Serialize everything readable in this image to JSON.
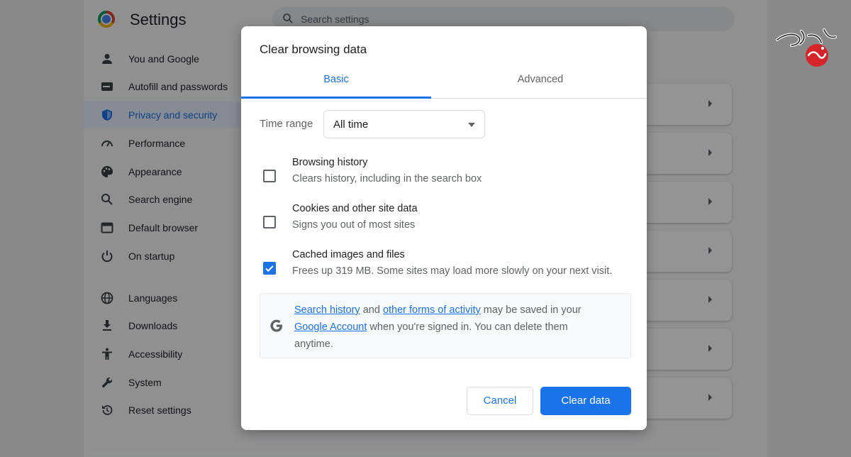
{
  "app": {
    "title": "Settings",
    "search_placeholder": "Search settings"
  },
  "nav": {
    "items": [
      {
        "label": "You and Google",
        "icon": "person-icon"
      },
      {
        "label": "Autofill and passwords",
        "icon": "card-icon"
      },
      {
        "label": "Privacy and security",
        "icon": "shield-icon",
        "active": true
      },
      {
        "label": "Performance",
        "icon": "speedometer-icon"
      },
      {
        "label": "Appearance",
        "icon": "palette-icon"
      },
      {
        "label": "Search engine",
        "icon": "search-icon"
      },
      {
        "label": "Default browser",
        "icon": "browser-icon"
      },
      {
        "label": "On startup",
        "icon": "power-icon"
      },
      {
        "label": "Languages",
        "icon": "globe-icon"
      },
      {
        "label": "Downloads",
        "icon": "download-icon"
      },
      {
        "label": "Accessibility",
        "icon": "accessibility-icon"
      },
      {
        "label": "System",
        "icon": "wrench-icon"
      },
      {
        "label": "Reset settings",
        "icon": "reset-icon"
      }
    ]
  },
  "dialog": {
    "title": "Clear browsing data",
    "tabs": {
      "basic": "Basic",
      "advanced": "Advanced"
    },
    "time_range": {
      "label": "Time range",
      "value": "All time"
    },
    "options": [
      {
        "title": "Browsing history",
        "desc": "Clears history, including in the search box",
        "checked": false
      },
      {
        "title": "Cookies and other site data",
        "desc": "Signs you out of most sites",
        "checked": false
      },
      {
        "title": "Cached images and files",
        "desc": "Frees up 319 MB. Some sites may load more slowly on your next visit.",
        "checked": true
      }
    ],
    "info": {
      "link1": "Search history",
      "text1": " and ",
      "link2": "other forms of activity",
      "text2": " may be saved in your ",
      "link3": "Google Account",
      "text3": " when you're signed in. You can delete them anytime."
    },
    "buttons": {
      "cancel": "Cancel",
      "clear": "Clear data"
    }
  },
  "colors": {
    "accent": "#1a73e8",
    "text": "#202124",
    "secondary_text": "#5f6368"
  }
}
